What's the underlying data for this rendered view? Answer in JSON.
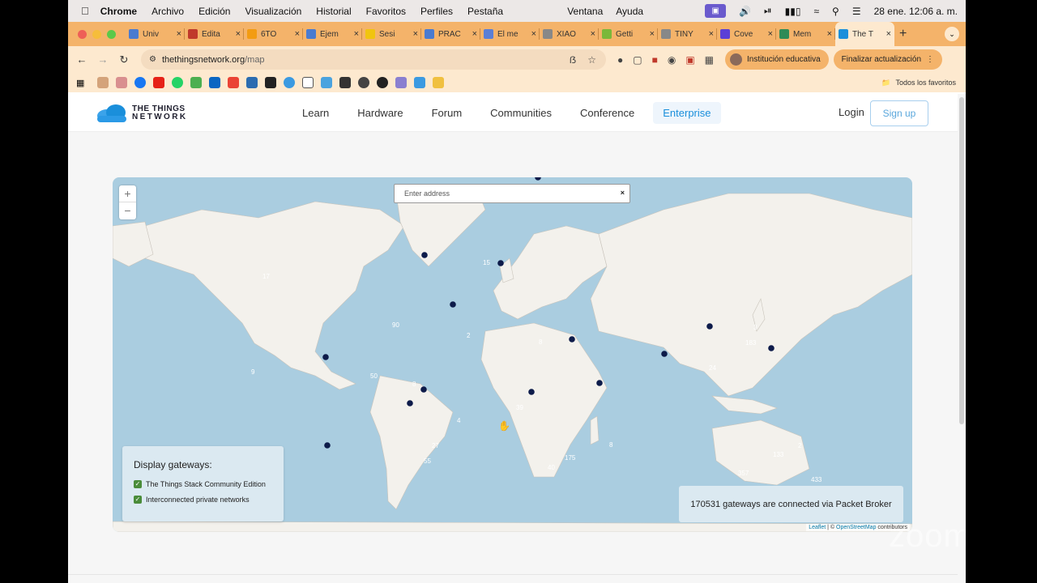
{
  "menubar": {
    "app": "Chrome",
    "items": [
      "Archivo",
      "Edición",
      "Visualización",
      "Historial",
      "Favoritos",
      "Perfiles",
      "Pestaña"
    ],
    "right_items": [
      "Ventana",
      "Ayuda"
    ],
    "clock": "28 ene.  12:06 a. m."
  },
  "tabs": [
    {
      "label": "Univ",
      "color": "#4a7bd0"
    },
    {
      "label": "Edita",
      "color": "#c0392b"
    },
    {
      "label": "6TO",
      "color": "#f39c12"
    },
    {
      "label": "Ejem",
      "color": "#4a7bd0"
    },
    {
      "label": "Sesi",
      "color": "#f1c40f"
    },
    {
      "label": "PRAC",
      "color": "#4a7bd0"
    },
    {
      "label": "El me",
      "color": "#5b7fd6"
    },
    {
      "label": "XIAO",
      "color": "#888888"
    },
    {
      "label": "Getti",
      "color": "#7bb83a"
    },
    {
      "label": "TINY",
      "color": "#888888"
    },
    {
      "label": "Cove",
      "color": "#5b3fd6"
    },
    {
      "label": "Mem",
      "color": "#2e8b57"
    },
    {
      "label": "The T",
      "color": "#1a8fdb",
      "active": true
    }
  ],
  "address": {
    "host": "thethingsnetwork.org",
    "path": "/map"
  },
  "profile_label": "Institución educativa",
  "update_label": "Finalizar actualización",
  "bookmarks_all": "Todos los favoritos",
  "site": {
    "logo_line1": "THE THINGS",
    "logo_line2": "NETWORK",
    "nav": [
      "Learn",
      "Hardware",
      "Forum",
      "Communities",
      "Conference"
    ],
    "enterprise": "Enterprise",
    "login": "Login",
    "signup": "Sign up"
  },
  "map": {
    "search_placeholder": "Enter address",
    "zoom_in": "+",
    "zoom_out": "−",
    "legend_title": "Display gateways:",
    "legend_items": [
      "The Things Stack Community Edition",
      "Interconnected private networks"
    ],
    "counter": "170531 gateways are connected via Packet Broker",
    "attrib_leaflet": "Leaflet",
    "attrib_osm": "OpenStreetMap",
    "attrib_rest": "contributors",
    "cluster_labels": [
      "17",
      "90",
      "2",
      "9",
      "50",
      "8",
      "39",
      "4",
      "27",
      "55",
      "175",
      "40",
      "8",
      "3",
      "183",
      "24",
      "133",
      "357",
      "2",
      "433",
      "15",
      "8"
    ]
  },
  "watermark": "zoom"
}
